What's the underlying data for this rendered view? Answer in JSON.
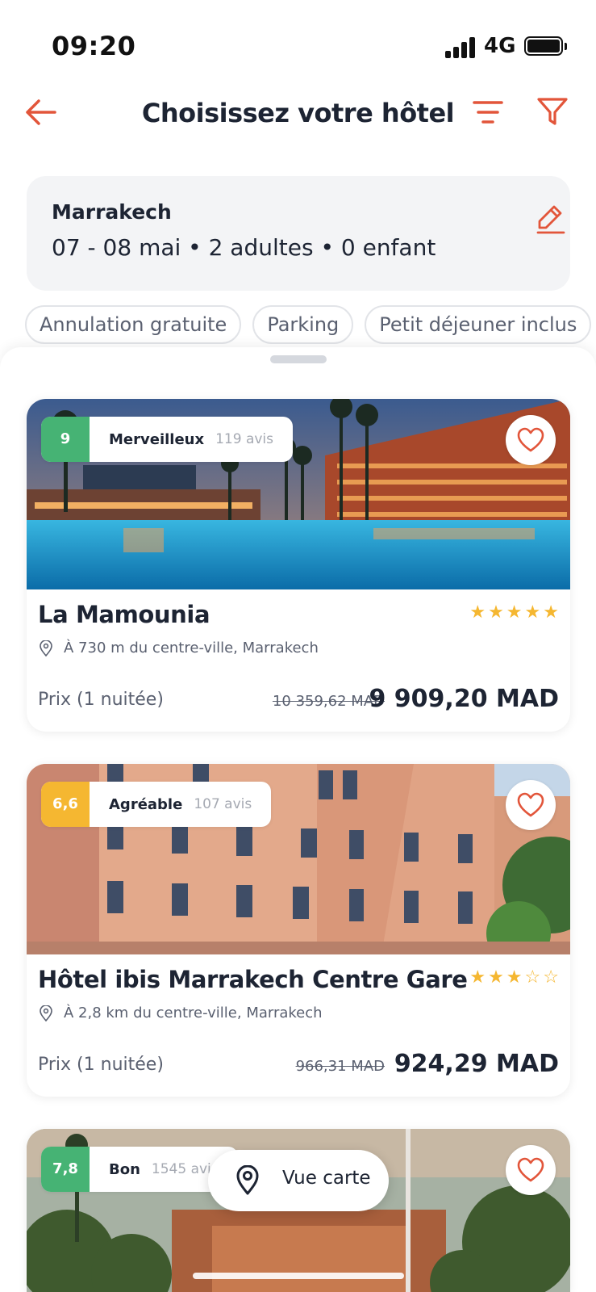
{
  "status": {
    "time": "09:20",
    "network": "4G",
    "battery_icon": "battery-full-icon"
  },
  "header": {
    "title": "Choisissez votre hôtel",
    "back_icon": "arrow-left-icon",
    "sort_icon": "sort-icon",
    "filter_icon": "filter-icon"
  },
  "search": {
    "city": "Marrakech",
    "details": "07 - 08 mai • 2 adultes • 0 enfant",
    "edit_icon": "pencil-icon"
  },
  "chips": [
    "Annulation gratuite",
    "Parking",
    "Petit déjeuner inclus"
  ],
  "hotels": [
    {
      "score": "9",
      "score_color": "#46b374",
      "rating_label": "Merveilleux",
      "reviews": "119 avis",
      "name": "La Mamounia",
      "stars": 5,
      "location": "À 730 m du centre-ville, Marrakech",
      "price_label": "Prix (1 nuitée)",
      "old_price": "10 359,62 MAD",
      "price": "9 909,20 MAD"
    },
    {
      "score": "6,6",
      "score_color": "#f5b731",
      "rating_label": "Agréable",
      "reviews": "107 avis",
      "name": "Hôtel ibis Marrakech Centre Gare",
      "stars": 3,
      "location": "À 2,8 km du centre-ville, Marrakech",
      "price_label": "Prix (1 nuitée)",
      "old_price": "966,31 MAD",
      "price": "924,29 MAD"
    },
    {
      "score": "7,8",
      "score_color": "#46b374",
      "rating_label": "Bon",
      "reviews": "1545 avis"
    }
  ],
  "map_button": {
    "label": "Vue carte",
    "icon": "map-pin-icon"
  },
  "colors": {
    "accent": "#e2553a",
    "star": "#f5b731",
    "text": "#1d2433",
    "muted": "#5a6070"
  }
}
